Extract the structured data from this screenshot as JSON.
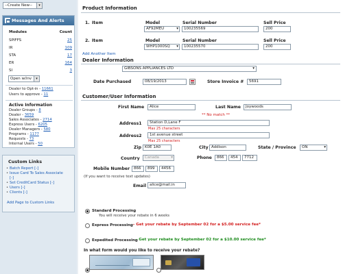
{
  "sidebar": {
    "create_new": "--Create New--",
    "messages_title": "Messages And Alerts",
    "modules_header": "Modules",
    "count_header": "Count",
    "modules": [
      {
        "label": "SPIFFS",
        "count": "25"
      },
      {
        "label": "IR",
        "count": "109"
      },
      {
        "label": "STA",
        "count": "17"
      },
      {
        "label": "ER",
        "count": "164"
      },
      {
        "label": "SI",
        "count": "3"
      }
    ],
    "open_select": "Open w/inv",
    "dealer_optin_label": "Dealer to Opt-in - ",
    "dealer_optin_count": "11661",
    "users_approve_label": "Users to approve - ",
    "users_approve_count": "11",
    "active_info_title": "Active Information",
    "active_info": [
      {
        "label": "Dealer Groups - ",
        "count": "8"
      },
      {
        "label": "Dealer - ",
        "count": "3659"
      },
      {
        "label": "Sales Associates - ",
        "count": "2714"
      },
      {
        "label": "Express Users - ",
        "count": "6205"
      },
      {
        "label": "Dealer Managers - ",
        "count": "580"
      },
      {
        "label": "Programs - ",
        "count": "1177"
      },
      {
        "label": "Requests - ",
        "count": "73"
      },
      {
        "label": "Internal Users - ",
        "count": "50"
      }
    ],
    "custom_links_title": "Custom Links",
    "custom_links": [
      "Batch Report [-]",
      "Issue Card To Sales Associate [-]",
      "Set CreditCard Status [-]",
      "Users [-]",
      "Clients [-]"
    ],
    "add_page": "Add Page to Custom Links"
  },
  "product": {
    "title": "Product Information",
    "rows": [
      {
        "num": "1.",
        "item_label": "Item",
        "model_label": "Model",
        "serial_label": "Serial Number",
        "price_label": "Sell Price",
        "model": "AF92MEU",
        "serial": "100235569",
        "price": "200"
      },
      {
        "num": "2.",
        "item_label": "Item",
        "model_label": "Model",
        "serial_label": "Serial Number",
        "price_label": "Sell Price",
        "model": "WHP1000SQ",
        "serial": "100235570",
        "price": "200"
      }
    ],
    "add_another": "Add Another Item"
  },
  "dealer": {
    "title": "Dealer Information",
    "dealer_select": "GIBSONS APPLIANCES LTD",
    "date_label": "Date Purchased",
    "date_value": "08/19/2013",
    "invoice_label": "Store Invoice #",
    "invoice_value": "5691"
  },
  "customer": {
    "title": "Customer/User Information",
    "first_name_label": "First Name",
    "first_name": "Alice",
    "last_name_label": "Last Name",
    "last_name": "Joywoods",
    "no_match": "** No match **",
    "address1_label": "Address1",
    "address1": "Station D,Lane F",
    "max25": "Max 25 characters",
    "address2_label": "Address2",
    "address2": "1st avenue street",
    "max25b": "Max 25 characters",
    "zip_label": "Zip",
    "zip": "K0E 1A0",
    "city_label": "City",
    "city": "Addison",
    "state_label": "State / Province",
    "state": "ON",
    "country_label": "Country",
    "country": "Canada",
    "phone_label": "Phone",
    "phone1": "866",
    "phone2": "454",
    "phone3": "7712",
    "mobile_label": "Mobile Number",
    "mobile1": "866",
    "mobile2": "899",
    "mobile3": "4456",
    "text_updates": "(If you want to receive text updates)",
    "email_label": "Email",
    "email": "alice@mail.in"
  },
  "processing": {
    "standard_title": "Standard Processing",
    "standard_desc": "You will receive your rebate in 6 weeks",
    "express_title": "Express Processing",
    "express_desc": " - Get your rebate by September 02 for a $5.00 service fee*",
    "expedited_title": "Expedited Processing",
    "expedited_desc": " - Get your rebate by September 02 for a $10.00 service fee*",
    "form_question": "In what form would you like to receive your rebate?"
  },
  "colors": {
    "link": "#1a5bb4",
    "express_red": "#d21a1a",
    "expedited_green": "#1b8a1b",
    "header_blue": "#3d6e9b"
  }
}
